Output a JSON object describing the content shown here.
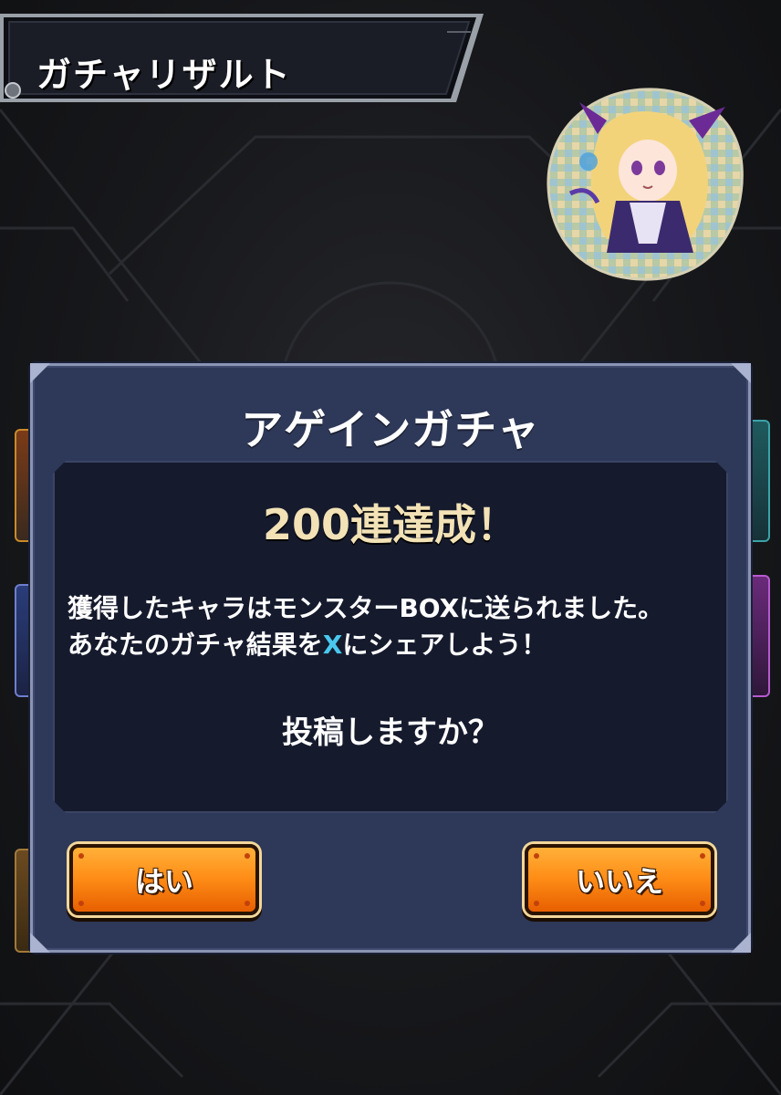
{
  "header": {
    "title": "ガチャリザルト"
  },
  "dialog": {
    "title": "アゲインガチャ",
    "achievement": "200連達成！",
    "message_line1": "獲得したキャラはモンスターBOXに送られました。",
    "message_line2_pre": "あなたのガチャ結果を",
    "message_line2_x": "X",
    "message_line2_post": "にシェアしよう！",
    "question": "投稿しますか？",
    "yes_label": "はい",
    "no_label": "いいえ"
  },
  "colors": {
    "dialog_bg": "#2e3858",
    "inner_bg": "#151a2d",
    "achievement_text": "#f2e2b6",
    "x_highlight": "#49c8ee",
    "button_orange": "#ff8f18"
  },
  "icons": [
    "character-badge-icon",
    "header-emblem-icon"
  ]
}
